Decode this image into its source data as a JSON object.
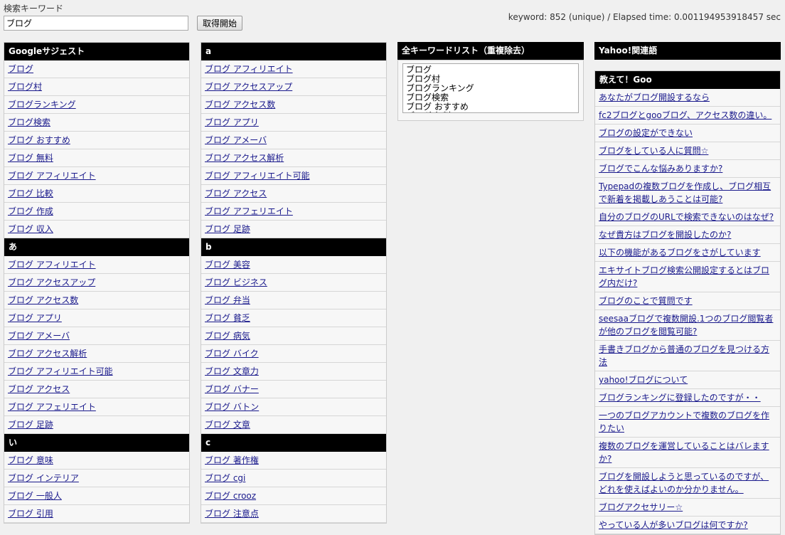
{
  "search": {
    "label": "検索キーワード",
    "value": "ブログ",
    "button_label": "取得開始"
  },
  "stats_text": "keyword: 852 (unique) / Elapsed time: 0.001194953918457 sec",
  "google": {
    "title": "Googleサジェスト",
    "items": [
      "ブログ",
      "ブログ村",
      "ブログランキング",
      "ブログ検索",
      "ブログ おすすめ",
      "ブログ 無料",
      "ブログ アフィリエイト",
      "ブログ 比較",
      "ブログ 作成",
      "ブログ 収入"
    ]
  },
  "a_jp": {
    "title": "あ",
    "items": [
      "ブログ アフィリエイト",
      "ブログ アクセスアップ",
      "ブログ アクセス数",
      "ブログ アプリ",
      "ブログ アメーバ",
      "ブログ アクセス解析",
      "ブログ アフィリエイト可能",
      "ブログ アクセス",
      "ブログ アフェリエイト",
      "ブログ 足跡"
    ]
  },
  "i_jp": {
    "title": "い",
    "items": [
      "ブログ 意味",
      "ブログ インテリア",
      "ブログ 一般人",
      "ブログ 引用"
    ]
  },
  "a_en": {
    "title": "a",
    "items": [
      "ブログ アフィリエイト",
      "ブログ アクセスアップ",
      "ブログ アクセス数",
      "ブログ アプリ",
      "ブログ アメーバ",
      "ブログ アクセス解析",
      "ブログ アフィリエイト可能",
      "ブログ アクセス",
      "ブログ アフェリエイト",
      "ブログ 足跡"
    ]
  },
  "b_en": {
    "title": "b",
    "items": [
      "ブログ 美容",
      "ブログ ビジネス",
      "ブログ 弁当",
      "ブログ 貧乏",
      "ブログ 病気",
      "ブログ バイク",
      "ブログ 文章力",
      "ブログ バナー",
      "ブログ バトン",
      "ブログ 文章"
    ]
  },
  "c_en": {
    "title": "c",
    "items": [
      "ブログ 著作権",
      "ブログ cgi",
      "ブログ crooz",
      "ブログ 注意点"
    ]
  },
  "all_list": {
    "title": "全キーワードリスト（重複除去）",
    "text": "ブログ\nブログ村\nブログランキング\nブログ検索\nブログ おすすめ\nブログ 無料"
  },
  "yahoo": {
    "title": "Yahoo!関連語"
  },
  "goo": {
    "title": "教えて！Goo",
    "items": [
      "あなたがブログ開設するなら",
      "fc2ブログとgooブログ、アクセス数の違い。",
      "ブログの設定ができない",
      "ブログをしている人に質問☆",
      "ブログでこんな悩みありますか?",
      "Typepadの複数ブログを作成し、ブログ相互で新着を掲載しあうことは可能?",
      "自分のブログのURLで検索できないのはなぜ?",
      "なぜ貴方はブログを開設したのか?",
      "以下の機能があるブログをさがしています",
      "エキサイトブログ検索公開設定するとはブログ内だけ?",
      "ブログのことで質問です",
      "seesaaブログで複数開設.1つのブログ閲覧者が他のブログを閲覧可能?",
      "手書きブログから普通のブログを見つける方法",
      "yahoo!ブログについて",
      "ブログランキングに登録したのですが・・",
      "一つのブログアカウントで複数のブログを作りたい",
      "複数のブログを運営していることはバレますか?",
      "ブログを開設しようと思っているのですが、どれを使えばよいのか分かりません。",
      "ブログアクセサリー☆",
      "やっている人が多いブログは何ですか?"
    ]
  }
}
